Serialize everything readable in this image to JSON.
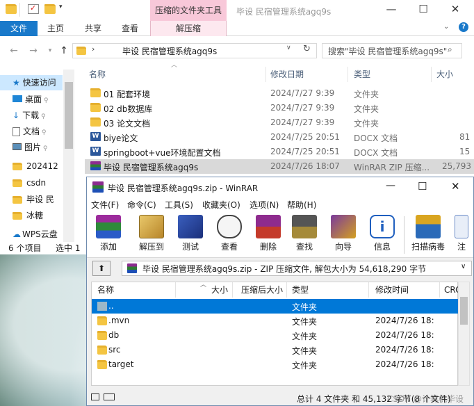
{
  "explorer": {
    "context_tab_group": "压缩的文件夹工具",
    "window_title": "毕设 民宿管理系统agq9s",
    "ribbon": {
      "file": "文件",
      "tabs": [
        "主页",
        "共享",
        "查看"
      ],
      "context_tab": "解压缩"
    },
    "address": "毕设 民宿管理系统agq9s",
    "search_placeholder": "搜索\"毕设 民宿管理系统agq9s\"",
    "columns": [
      "名称",
      "修改日期",
      "类型",
      "大小"
    ],
    "files": [
      {
        "name": "01 配套环境",
        "date": "2024/7/27 9:39",
        "type": "文件夹",
        "size": "",
        "icon": "folder-icon"
      },
      {
        "name": "02 db数据库",
        "date": "2024/7/27 9:39",
        "type": "文件夹",
        "size": "",
        "icon": "folder-icon"
      },
      {
        "name": "03 论文文档",
        "date": "2024/7/27 9:39",
        "type": "文件夹",
        "size": "",
        "icon": "folder-icon"
      },
      {
        "name": "biye论文",
        "date": "2024/7/25 20:51",
        "type": "DOCX 文档",
        "size": "81",
        "icon": "word-icon"
      },
      {
        "name": "springboot+vue环境配置文档",
        "date": "2024/7/25 20:51",
        "type": "DOCX 文档",
        "size": "15",
        "icon": "word-icon"
      },
      {
        "name": "毕设 民宿管理系统agq9s",
        "date": "2024/7/26 18:07",
        "type": "WinRAR ZIP 压缩...",
        "size": "25,793",
        "icon": "rar-icon",
        "selected": true
      }
    ],
    "nav": [
      {
        "label": "快速访问",
        "icon": "star-icon"
      },
      {
        "label": "桌面",
        "icon": "desktop-icon",
        "pinned": true
      },
      {
        "label": "下载",
        "icon": "download-icon",
        "pinned": true
      },
      {
        "label": "文档",
        "icon": "document-icon",
        "pinned": true
      },
      {
        "label": "图片",
        "icon": "picture-icon",
        "pinned": true
      },
      {
        "label": "202412",
        "icon": "folder-icon"
      },
      {
        "label": "csdn",
        "icon": "folder-icon"
      },
      {
        "label": "毕设 民",
        "icon": "folder-icon"
      },
      {
        "label": "冰糖",
        "icon": "folder-icon"
      },
      {
        "label": "WPS云盘",
        "icon": "cloud-icon"
      }
    ],
    "status_count": "6 个项目",
    "status_selected": "选中 1"
  },
  "winrar": {
    "title": "毕设 民宿管理系统agq9s.zip - WinRAR",
    "menu": [
      "文件(F)",
      "命令(C)",
      "工具(S)",
      "收藏夹(O)",
      "选项(N)",
      "帮助(H)"
    ],
    "toolbar": [
      {
        "label": "添加",
        "icon": "add-archive-icon"
      },
      {
        "label": "解压到",
        "icon": "extract-to-icon"
      },
      {
        "label": "测试",
        "icon": "test-icon"
      },
      {
        "label": "查看",
        "icon": "view-icon"
      },
      {
        "label": "删除",
        "icon": "delete-icon"
      },
      {
        "label": "查找",
        "icon": "find-icon"
      },
      {
        "label": "向导",
        "icon": "wizard-icon"
      },
      {
        "label": "信息",
        "icon": "info-icon"
      },
      {
        "label": "扫描病毒",
        "icon": "scan-virus-icon"
      },
      {
        "label": "注",
        "icon": "comment-icon"
      }
    ],
    "path": "毕设 民宿管理系统agq9s.zip - ZIP 压缩文件, 解包大小为 54,618,290 字节",
    "columns": [
      "名称",
      "大小",
      "压缩后大小",
      "类型",
      "修改时间",
      "CRC"
    ],
    "rows": [
      {
        "name": "..",
        "type": "文件夹",
        "modified": "",
        "selected": true
      },
      {
        "name": ".mvn",
        "type": "文件夹",
        "modified": "2024/7/26 18:"
      },
      {
        "name": "db",
        "type": "文件夹",
        "modified": "2024/7/26 18:"
      },
      {
        "name": "src",
        "type": "文件夹",
        "modified": "2024/7/26 18:"
      },
      {
        "name": "target",
        "type": "文件夹",
        "modified": "2024/7/26 18:"
      }
    ],
    "status_total": "总计 4 文件夹 和 45,132 字节(8 个文件)",
    "watermark": "CSDN @计算机毕设"
  },
  "colors": {
    "accent": "#1979ca",
    "context_tab": "#f8c8d9",
    "selection": "#0078d7"
  }
}
